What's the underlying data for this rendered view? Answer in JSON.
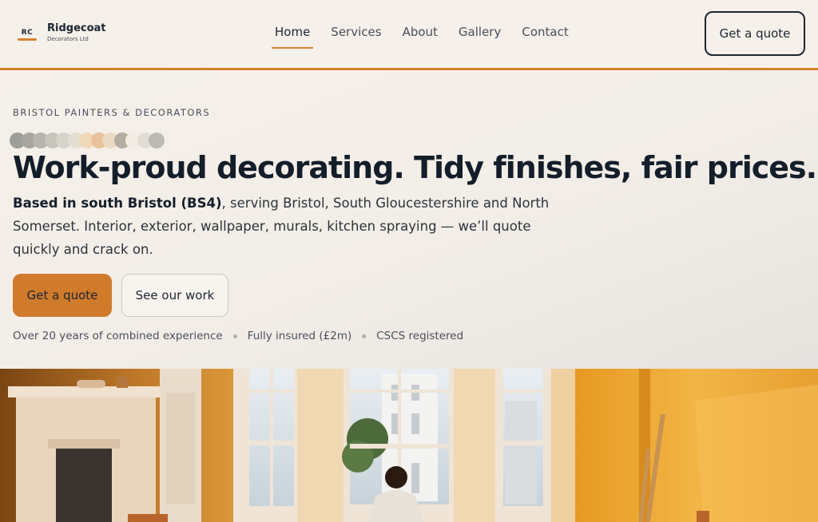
{
  "brand": {
    "monogram": "RC",
    "name": "Ridgecoat",
    "subtitle": "Decorators Ltd"
  },
  "nav": {
    "items": [
      {
        "label": "Home",
        "active": true
      },
      {
        "label": "Services",
        "active": false
      },
      {
        "label": "About",
        "active": false
      },
      {
        "label": "Gallery",
        "active": false
      },
      {
        "label": "Contact",
        "active": false
      }
    ],
    "cta_label": "Get a quote"
  },
  "hero": {
    "eyebrow": "BRISTOL PAINTERS & DECORATORS",
    "swatch_colors": [
      "#9d9d99",
      "#a7a6a1",
      "#b6b4ad",
      "#c8c5bd",
      "#d6d3cb",
      "#e3ddd2",
      "#efd7b8",
      "#e9c29a",
      "#ebd9c2",
      "#b5ada0",
      "#f2ece3",
      "#e1ddd5",
      "#bdbab4"
    ],
    "title": "Work-proud decorating. Tidy finishes, fair prices.",
    "desc_strong": "Based in south Bristol (BS4)",
    "desc_rest": ", serving Bristol, South Gloucestershire and North Somerset. Interior, exterior, wallpaper, murals, kitchen spraying — we’ll quote quickly and crack on.",
    "primary_label": "Get a quote",
    "secondary_label": "See our work",
    "trust": [
      "Over 20 years of combined experience",
      "Fully insured (£2m)",
      "CSCS registered"
    ]
  },
  "colors": {
    "accent": "#d6812f",
    "background": "#f5f0ea",
    "ink": "#1c2530"
  }
}
